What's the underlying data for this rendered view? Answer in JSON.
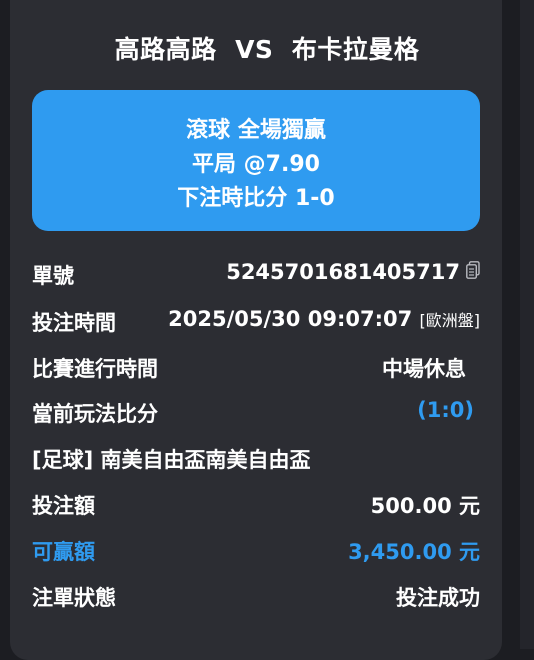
{
  "match": {
    "home": "高路高路",
    "vs": "VS",
    "away": "布卡拉曼格"
  },
  "bet_box": {
    "type": "滾球 全場獨贏",
    "selection": "平局 @7.90",
    "score_at_bet": "下注時比分 1-0"
  },
  "details": {
    "order_no_label": "單號",
    "order_no": "5245701681405717",
    "copy_icon": "copy-icon",
    "bet_time_label": "投注時間",
    "bet_time": "2025/05/30 09:07:07",
    "market": "[歐洲盤]",
    "match_time_label": "比賽進行時間",
    "match_time": "中場休息",
    "current_score_label": "當前玩法比分",
    "current_score": "(1:0)",
    "league": "[足球] 南美自由盃南美自由盃",
    "stake_label": "投注額",
    "stake": "500.00 元",
    "payout_label": "可贏額",
    "payout": "3,450.00 元",
    "status_label": "注單狀態",
    "status": "投注成功"
  },
  "colors": {
    "accent": "#2f9bf0",
    "card": "#2c2d33",
    "background": "#1c1d22"
  }
}
